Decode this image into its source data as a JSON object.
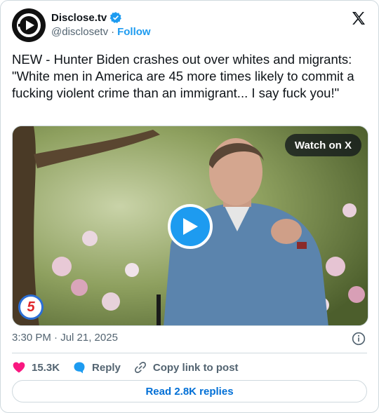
{
  "account": {
    "name": "Disclose.tv",
    "handle": "@disclosetv",
    "separator": "·",
    "follow_label": "Follow"
  },
  "post": {
    "text": "NEW - Hunter Biden crashes out over whites and migrants: \"White men in America are 45 more times likely to commit a fucking violent crime than an immigrant... I say fuck you!\"",
    "timestamp": "3:30 PM · Jul 21, 2025"
  },
  "media": {
    "watch_label": "Watch on X",
    "channel_badge": "5"
  },
  "actions": {
    "like_count": "15.3K",
    "reply_label": "Reply",
    "copy_label": "Copy link to post"
  },
  "footer": {
    "read_replies_label": "Read 2.8K replies"
  },
  "colors": {
    "brand_blue": "#1d9bf0",
    "like_pink": "#f91880",
    "text_secondary": "#536471"
  }
}
